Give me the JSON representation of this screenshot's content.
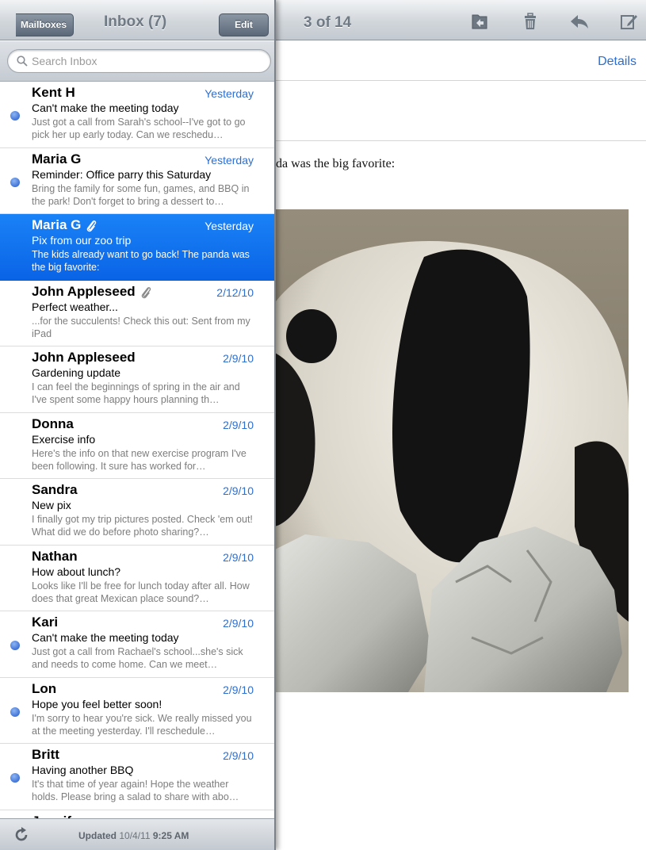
{
  "toolbar": {
    "position": "3 of 14",
    "icons": [
      "folder-move-icon",
      "trash-icon",
      "reply-icon",
      "compose-icon"
    ],
    "details_label": "Details"
  },
  "message": {
    "body_text": "da was the big favorite:"
  },
  "mailbox": {
    "back_label": "Mailboxes",
    "title": "Inbox (7)",
    "edit_label": "Edit",
    "search_placeholder": "Search Inbox",
    "search_value": ""
  },
  "emails": [
    {
      "sender": "Kent H",
      "date": "Yesterday",
      "subject": "Can't make the meeting today",
      "preview": "Just got a call from Sarah's school--I've got to go pick her up early today. Can we reschedu…",
      "unread": true,
      "attachment": false,
      "selected": false
    },
    {
      "sender": "Maria G",
      "date": "Yesterday",
      "subject": "Reminder: Office parry this Saturday",
      "preview": "Bring the family for some fun, games, and BBQ in the park! Don't forget to bring a dessert to…",
      "unread": true,
      "attachment": false,
      "selected": false
    },
    {
      "sender": "Maria G",
      "date": "Yesterday",
      "subject": "Pix from our zoo trip",
      "preview": "The kids already want to go back! The panda was the big favorite:",
      "unread": false,
      "attachment": true,
      "selected": true
    },
    {
      "sender": "John Appleseed",
      "date": "2/12/10",
      "subject": "Perfect weather...",
      "preview": "...for the succulents! Check this out: Sent from my iPad",
      "unread": false,
      "attachment": true,
      "selected": false
    },
    {
      "sender": "John Appleseed",
      "date": "2/9/10",
      "subject": "Gardening update",
      "preview": "I can feel the beginnings of spring in the air and I've spent some happy hours planning th…",
      "unread": false,
      "attachment": false,
      "selected": false
    },
    {
      "sender": "Donna",
      "date": "2/9/10",
      "subject": "Exercise info",
      "preview": "Here's the info on that new exercise program I've been following. It sure has worked for…",
      "unread": false,
      "attachment": false,
      "selected": false
    },
    {
      "sender": "Sandra",
      "date": "2/9/10",
      "subject": "New pix",
      "preview": "I finally got my trip pictures posted. Check 'em out! What did we do before photo sharing?…",
      "unread": false,
      "attachment": false,
      "selected": false
    },
    {
      "sender": "Nathan",
      "date": "2/9/10",
      "subject": "How about lunch?",
      "preview": "Looks like I'll be free for lunch today after all. How does that great Mexican place sound?…",
      "unread": false,
      "attachment": false,
      "selected": false
    },
    {
      "sender": "Kari",
      "date": "2/9/10",
      "subject": "Can't make the meeting today",
      "preview": "Just got a call from Rachael's school...she's sick and needs to come home. Can we meet…",
      "unread": true,
      "attachment": false,
      "selected": false
    },
    {
      "sender": "Lon",
      "date": "2/9/10",
      "subject": "Hope you feel better soon!",
      "preview": "I'm sorry to hear you're sick. We really missed you at the meeting yesterday. I'll reschedule…",
      "unread": true,
      "attachment": false,
      "selected": false
    },
    {
      "sender": "Britt",
      "date": "2/9/10",
      "subject": "Having another BBQ",
      "preview": "It's that time of year again! Hope the weather holds. Please bring a salad to share with abo…",
      "unread": true,
      "attachment": false,
      "selected": false
    },
    {
      "sender": "Jennifer",
      "date": "2/9/10",
      "subject": "",
      "preview": "",
      "unread": false,
      "attachment": false,
      "selected": false,
      "partial": true
    }
  ],
  "footer": {
    "updated_label": "Updated",
    "updated_date": "10/4/11",
    "updated_time": "9:25 AM"
  },
  "colors": {
    "accent": "#2c6fd1",
    "selection": "#0a64e6",
    "unread_dot": "#3f73d8"
  }
}
